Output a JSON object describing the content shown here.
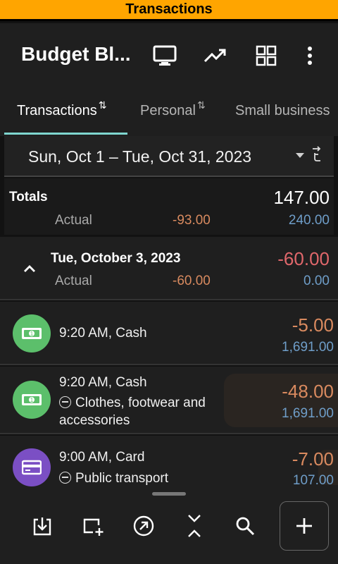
{
  "titlebar": {
    "title": "Transactions"
  },
  "appbar": {
    "title": "Budget Bl...",
    "icons": [
      "monitor-icon",
      "trending-up-icon",
      "grid-icon",
      "more-vert-icon"
    ]
  },
  "tabs": [
    {
      "label": "Transactions",
      "active": true
    },
    {
      "label": "Personal",
      "active": false
    },
    {
      "label": "Small business",
      "active": false
    }
  ],
  "period": {
    "range": "Sun, Oct 1 – Tue, Oct 31, 2023"
  },
  "totals": {
    "label": "Totals",
    "value": "147.00",
    "actual_label": "Actual",
    "actual_expense": "-93.00",
    "actual_income": "240.00"
  },
  "day_group": {
    "date": "Tue, October 3, 2023",
    "value": "-60.00",
    "actual_label": "Actual",
    "actual_expense": "-60.00",
    "actual_income": "0.00"
  },
  "transactions": [
    {
      "time_account": "9:20 AM, Cash",
      "category": "",
      "amount": "-5.00",
      "balance": "1,691.00",
      "icon": "cash-icon",
      "color": "#5cbf6b"
    },
    {
      "time_account": "9:20 AM, Cash",
      "category": "Clothes, footwear and accessories",
      "amount": "-48.00",
      "balance": "1,691.00",
      "icon": "cash-icon",
      "color": "#5cbf6b"
    },
    {
      "time_account": "9:00 AM, Card",
      "category": "Public transport",
      "amount": "-7.00",
      "balance": "107.00",
      "icon": "credit-card-icon",
      "color": "#7b4fc4"
    }
  ],
  "bottom_bar": {
    "icons": [
      "import-icon",
      "add-card-icon",
      "arrow-circle-icon",
      "collapse-all-icon",
      "search-icon",
      "add-icon"
    ]
  },
  "colors": {
    "accent": "#ffa500",
    "tab_indicator": "#7fd6cf",
    "negative_orange": "#d88a5f",
    "negative_red": "#e0676b",
    "positive_blue": "#6f9ec9"
  }
}
